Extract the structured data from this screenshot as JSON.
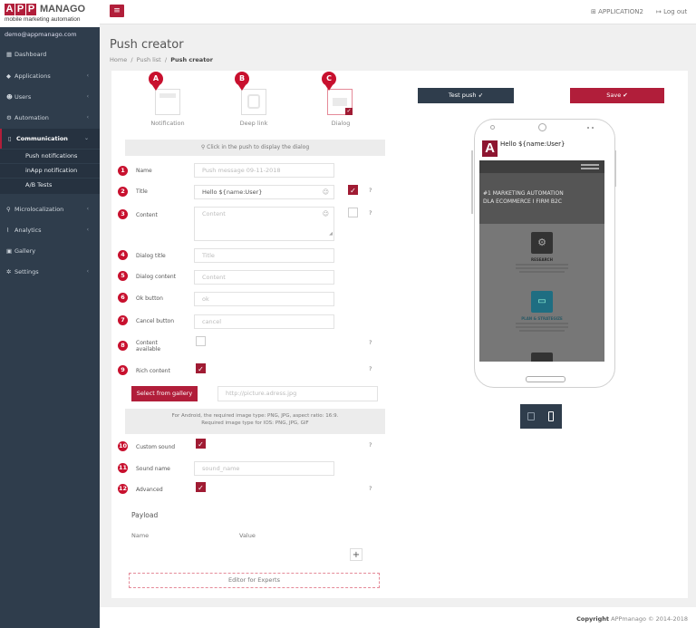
{
  "app": {
    "logo_letters": [
      "A",
      "P",
      "P"
    ],
    "logo_word": "MANAGO",
    "logo_sub": "mobile marketing automation",
    "user_email": "demo@appmanago.com",
    "app_name": "APPLICATION2",
    "logout_label": "Log out"
  },
  "sidebar": {
    "items": [
      {
        "label": "Dashboard",
        "icon": "dashboard-icon"
      },
      {
        "label": "Applications",
        "icon": "diamond-icon"
      },
      {
        "label": "Users",
        "icon": "users-icon"
      },
      {
        "label": "Automation",
        "icon": "gears-icon"
      },
      {
        "label": "Communication",
        "icon": "mobile-icon"
      },
      {
        "label": "Microlocalization",
        "icon": "pin-icon"
      },
      {
        "label": "Analytics",
        "icon": "chart-icon"
      },
      {
        "label": "Gallery",
        "icon": "image-icon"
      },
      {
        "label": "Settings",
        "icon": "gear-icon"
      }
    ],
    "sub_items": [
      "Push notifications",
      "inApp notification",
      "A/B Tests"
    ]
  },
  "header": {
    "title": "Push creator",
    "breadcrumbs": [
      "Home",
      "Push list",
      "Push creator"
    ]
  },
  "types": [
    {
      "marker": "A",
      "label": "Notification"
    },
    {
      "marker": "B",
      "label": "Deep link"
    },
    {
      "marker": "C",
      "label": "Dialog"
    }
  ],
  "hint": "Click in the push to display the dialog",
  "form": {
    "name": {
      "num": "1",
      "label": "Name",
      "value": "",
      "placeholder": "Push message 09-11-2018"
    },
    "title": {
      "num": "2",
      "label": "Title",
      "value": "Hello ${name:User}",
      "placeholder": ""
    },
    "content": {
      "num": "3",
      "label": "Content",
      "value": "",
      "placeholder": "Content"
    },
    "dialog_title": {
      "num": "4",
      "label": "Dialog title",
      "placeholder": "Title"
    },
    "dialog_content": {
      "num": "5",
      "label": "Dialog content",
      "placeholder": "Content"
    },
    "ok_button": {
      "num": "6",
      "label": "Ok button",
      "placeholder": "ok"
    },
    "cancel_button": {
      "num": "7",
      "label": "Cancel button",
      "placeholder": "cancel"
    },
    "content_available": {
      "num": "8",
      "label_1": "Content",
      "label_2": "available"
    },
    "rich_content": {
      "num": "9",
      "label": "Rich content"
    },
    "gallery_button": "Select from gallery",
    "picture_url_placeholder": "http://picture.adress.jpg",
    "image_info_1": "For Android, the required image type: PNG, JPG, aspect ratio: 16:9.",
    "image_info_2": "Required image type for IOS: PNG, JPG, GIF",
    "custom_sound": {
      "num": "10",
      "label": "Custom sound"
    },
    "sound_name": {
      "num": "11",
      "label": "Sound name",
      "placeholder": "sound_name"
    },
    "advanced": {
      "num": "12",
      "label": "Advanced"
    },
    "help_mark": "?"
  },
  "payload": {
    "title": "Payload",
    "col_name": "Name",
    "col_value": "Value",
    "add_label": "+"
  },
  "experts_label": "Editor for Experts",
  "actions": {
    "test_label": "Test push",
    "save_label": "Save"
  },
  "preview": {
    "logo_letter": "A",
    "push_title": "Hello ${name:User}",
    "banner_1": "#1 MARKETING AUTOMATION",
    "banner_2": "DLA ECOMMERCE I FIRM B2C",
    "section_1": "RESEARCH",
    "section_2": "PLAN & STRATEGIZE"
  },
  "footer": {
    "copyright_label": "Copyright",
    "copyright_text": "APPmanago © 2014-2018"
  },
  "colors": {
    "brand": "#b11e3a",
    "sidebar": "#2f3d4c",
    "marker": "#c8102e"
  }
}
